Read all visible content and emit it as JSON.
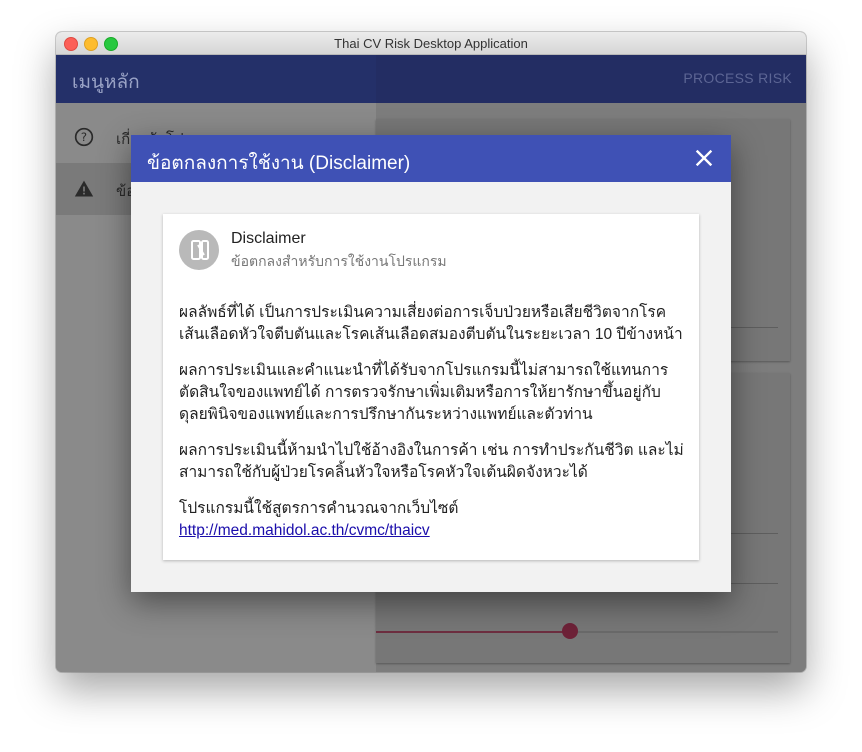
{
  "window": {
    "title": "Thai CV Risk Desktop Application"
  },
  "drawer": {
    "title": "เมนูหลัก",
    "items": [
      {
        "label": "เกี่ยวกับโปรแกรม",
        "icon": "help-circle-icon"
      },
      {
        "label": "ข้อ",
        "icon": "warning-icon"
      }
    ]
  },
  "appbar": {
    "process_label": "PROCESS RISK"
  },
  "dialog": {
    "title": "ข้อตกลงการใช้งาน (Disclaimer)",
    "close_icon": "close-icon",
    "card": {
      "title": "Disclaimer",
      "subtitle": "ข้อตกลงสำหรับการใช้งานโปรแกรม",
      "avatar_icon": "phonelink-erase-icon",
      "paragraphs": [
        "ผลลัพธ์ที่ได้ เป็นการประเมินความเสี่ยงต่อการเจ็บป่วยหรือเสียชีวิตจากโรคเส้นเลือดหัวใจตีบตันและโรคเส้นเลือดสมองตีบตันในระยะเวลา 10 ปีข้างหน้า",
        "ผลการประเมินและคำแนะนำที่ได้รับจากโปรแกรมนี้ไม่สามารถใช้แทนการตัดสินใจของแพทย์ได้ การตรวจรักษาเพิ่มเติมหรือการให้ยารักษาขึ้นอยู่กับดุลยพินิจของแพทย์และการปรึกษากันระหว่างแพทย์และตัวท่าน",
        "ผลการประเมินนี้ห้ามนำไปใช้อ้างอิงในการค้า เช่น การทำประกันชีวิต และไม่สามารถใช้กับผู้ป่วยโรคลิ้นหัวใจหรือโรคหัวใจเต้นผิดจังหวะได้"
      ],
      "source_text": "โปรแกรมนี้ใช้สูตรการคำนวณจากเว็บไซต์",
      "source_link": "http://med.mahidol.ac.th/cvmc/thaicv"
    }
  },
  "colors": {
    "primary": "#3f51b5",
    "appbar_dimmed": "#232d63",
    "slider_accent": "#6e2238"
  }
}
